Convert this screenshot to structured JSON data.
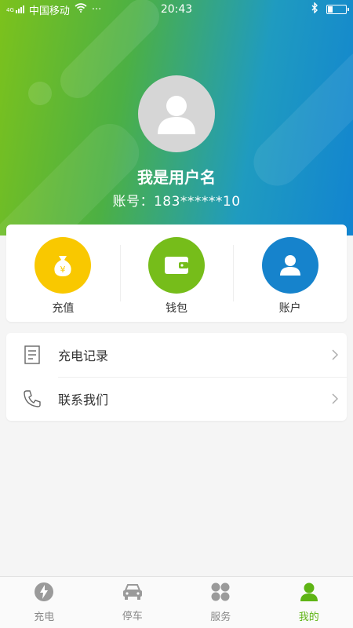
{
  "status_bar": {
    "carrier": "中国移动",
    "signal_label": "4G",
    "more": "···",
    "time": "20:43"
  },
  "profile": {
    "username": "我是用户名",
    "account": "账号：183******10"
  },
  "actions": [
    {
      "label": "充值",
      "color": "#f9c800",
      "icon": "money-bag-icon"
    },
    {
      "label": "钱包",
      "color": "#76bd1a",
      "icon": "wallet-icon"
    },
    {
      "label": "账户",
      "color": "#1683cc",
      "icon": "user-icon"
    }
  ],
  "menu": [
    {
      "label": "充电记录",
      "icon": "document-icon"
    },
    {
      "label": "联系我们",
      "icon": "phone-icon"
    }
  ],
  "tabs": [
    {
      "label": "充电",
      "icon": "lightning-icon",
      "active": false
    },
    {
      "label": "停车",
      "icon": "car-icon",
      "active": false
    },
    {
      "label": "服务",
      "icon": "clover-icon",
      "active": false
    },
    {
      "label": "我的",
      "icon": "person-icon",
      "active": true
    }
  ],
  "colors": {
    "accent": "#5eb414",
    "tab_inactive": "#888888"
  }
}
